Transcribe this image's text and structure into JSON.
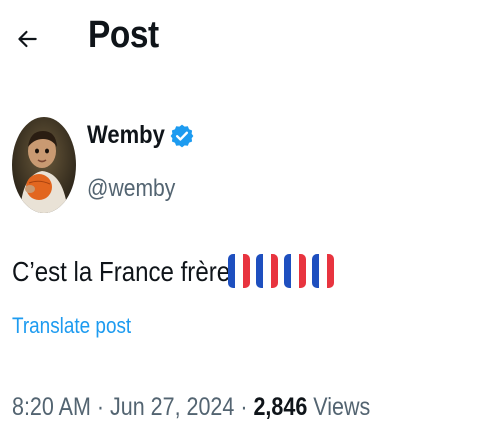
{
  "header": {
    "back_icon": "arrow-left-icon",
    "title": "Post"
  },
  "author": {
    "name": "Wemby",
    "handle": "@wemby",
    "verified_icon": "verified-badge-icon",
    "verified_color": "#1d9bf0"
  },
  "post": {
    "text": "C’est la France frère",
    "emoji": [
      "flag-france-icon",
      "flag-france-icon",
      "flag-france-icon",
      "flag-france-icon"
    ],
    "translate_label": "Translate post"
  },
  "meta": {
    "time": "8:20 AM",
    "separator": "·",
    "date": "Jun 27, 2024",
    "views_count": "2,846",
    "views_label": "Views"
  },
  "colors": {
    "text": "#0f1419",
    "secondary": "#536471",
    "link": "#1d9bf0",
    "flag_blue": "#1e4fbf",
    "flag_white": "#ffffff",
    "flag_red": "#e8343f"
  }
}
